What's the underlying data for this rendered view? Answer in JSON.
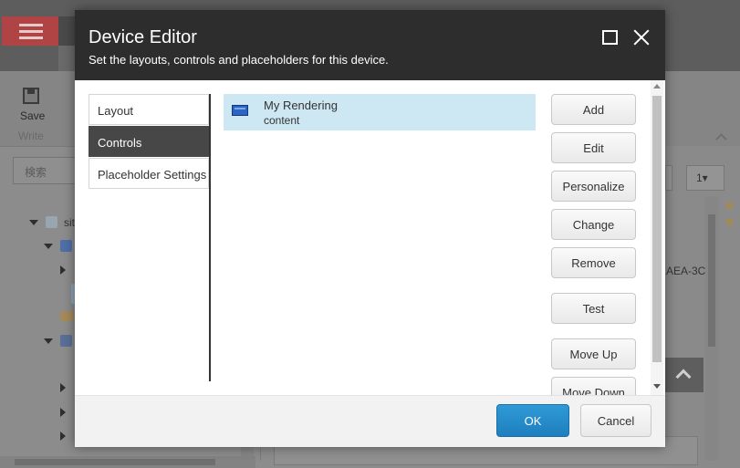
{
  "background": {
    "ribbon": {
      "save_label": "Save",
      "write_label": "Write"
    },
    "search": {
      "placeholder": "検索"
    },
    "tree": {
      "root_label": "sit"
    },
    "pager": {
      "value": "1▾"
    },
    "code_text": "AEA-3C:"
  },
  "dialog": {
    "title": "Device Editor",
    "subtitle": "Set the layouts, controls and placeholders for this device.",
    "nav": [
      {
        "label": "Layout",
        "active": false
      },
      {
        "label": "Controls",
        "active": true
      },
      {
        "label": "Placeholder Settings",
        "active": false
      }
    ],
    "renderings": [
      {
        "title": "My Rendering",
        "placeholder": "content",
        "icon": "rendering-icon",
        "selected": true
      }
    ],
    "buttons": {
      "add": "Add",
      "edit": "Edit",
      "personalize": "Personalize",
      "change": "Change",
      "remove": "Remove",
      "test": "Test",
      "move_up": "Move Up",
      "move_down": "Move Down"
    },
    "footer": {
      "ok": "OK",
      "cancel": "Cancel"
    },
    "colors": {
      "header": "#2d2d2d",
      "selected_row": "#cde7f3",
      "primary_button": "#1e7fbe",
      "active_nav": "#474747"
    }
  }
}
